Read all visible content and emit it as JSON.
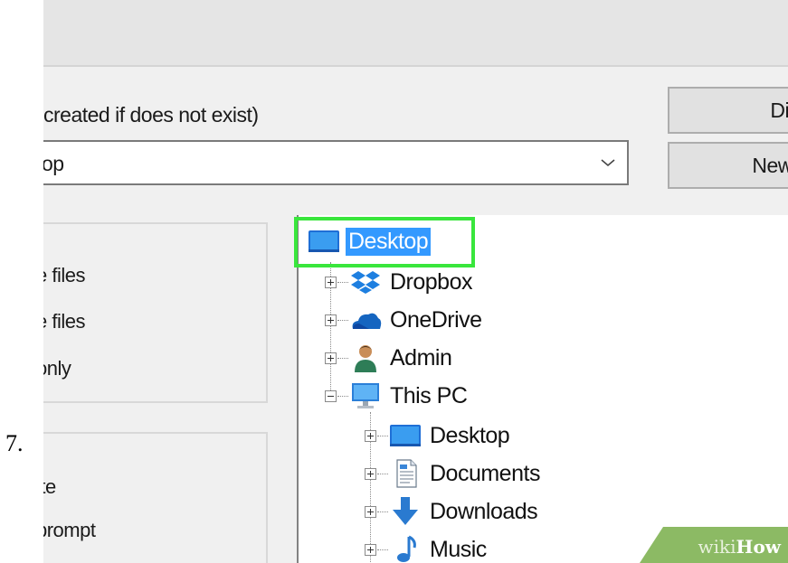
{
  "step": {
    "number": "7."
  },
  "dialog": {
    "path_label": "created if does not exist)",
    "path_combo": {
      "value": "op"
    },
    "buttons": {
      "display": "Displ",
      "new_folder": "New fo"
    },
    "options_group1": [
      "e files",
      "e files",
      "only"
    ],
    "options_group2": [
      "ite",
      "prompt"
    ]
  },
  "tree": {
    "root": {
      "label": "Desktop",
      "icon": "desktop-icon",
      "selected": true
    },
    "items": [
      {
        "label": "Dropbox",
        "icon": "dropbox-icon",
        "expander": "plus"
      },
      {
        "label": "OneDrive",
        "icon": "onedrive-icon",
        "expander": "plus"
      },
      {
        "label": "Admin",
        "icon": "user-icon",
        "expander": "plus"
      },
      {
        "label": "This PC",
        "icon": "computer-icon",
        "expander": "minus"
      }
    ],
    "this_pc_children": [
      {
        "label": "Desktop",
        "icon": "desktop-icon",
        "expander": "plus"
      },
      {
        "label": "Documents",
        "icon": "documents-icon",
        "expander": "plus"
      },
      {
        "label": "Downloads",
        "icon": "downloads-icon",
        "expander": "plus"
      },
      {
        "label": "Music",
        "icon": "music-icon",
        "expander": "plus"
      }
    ]
  },
  "watermark": {
    "wiki": "wiki",
    "how": "How"
  },
  "colors": {
    "selection_bg": "#3399ff",
    "highlight_border": "#39e63c",
    "watermark_green": "#8cba64"
  }
}
